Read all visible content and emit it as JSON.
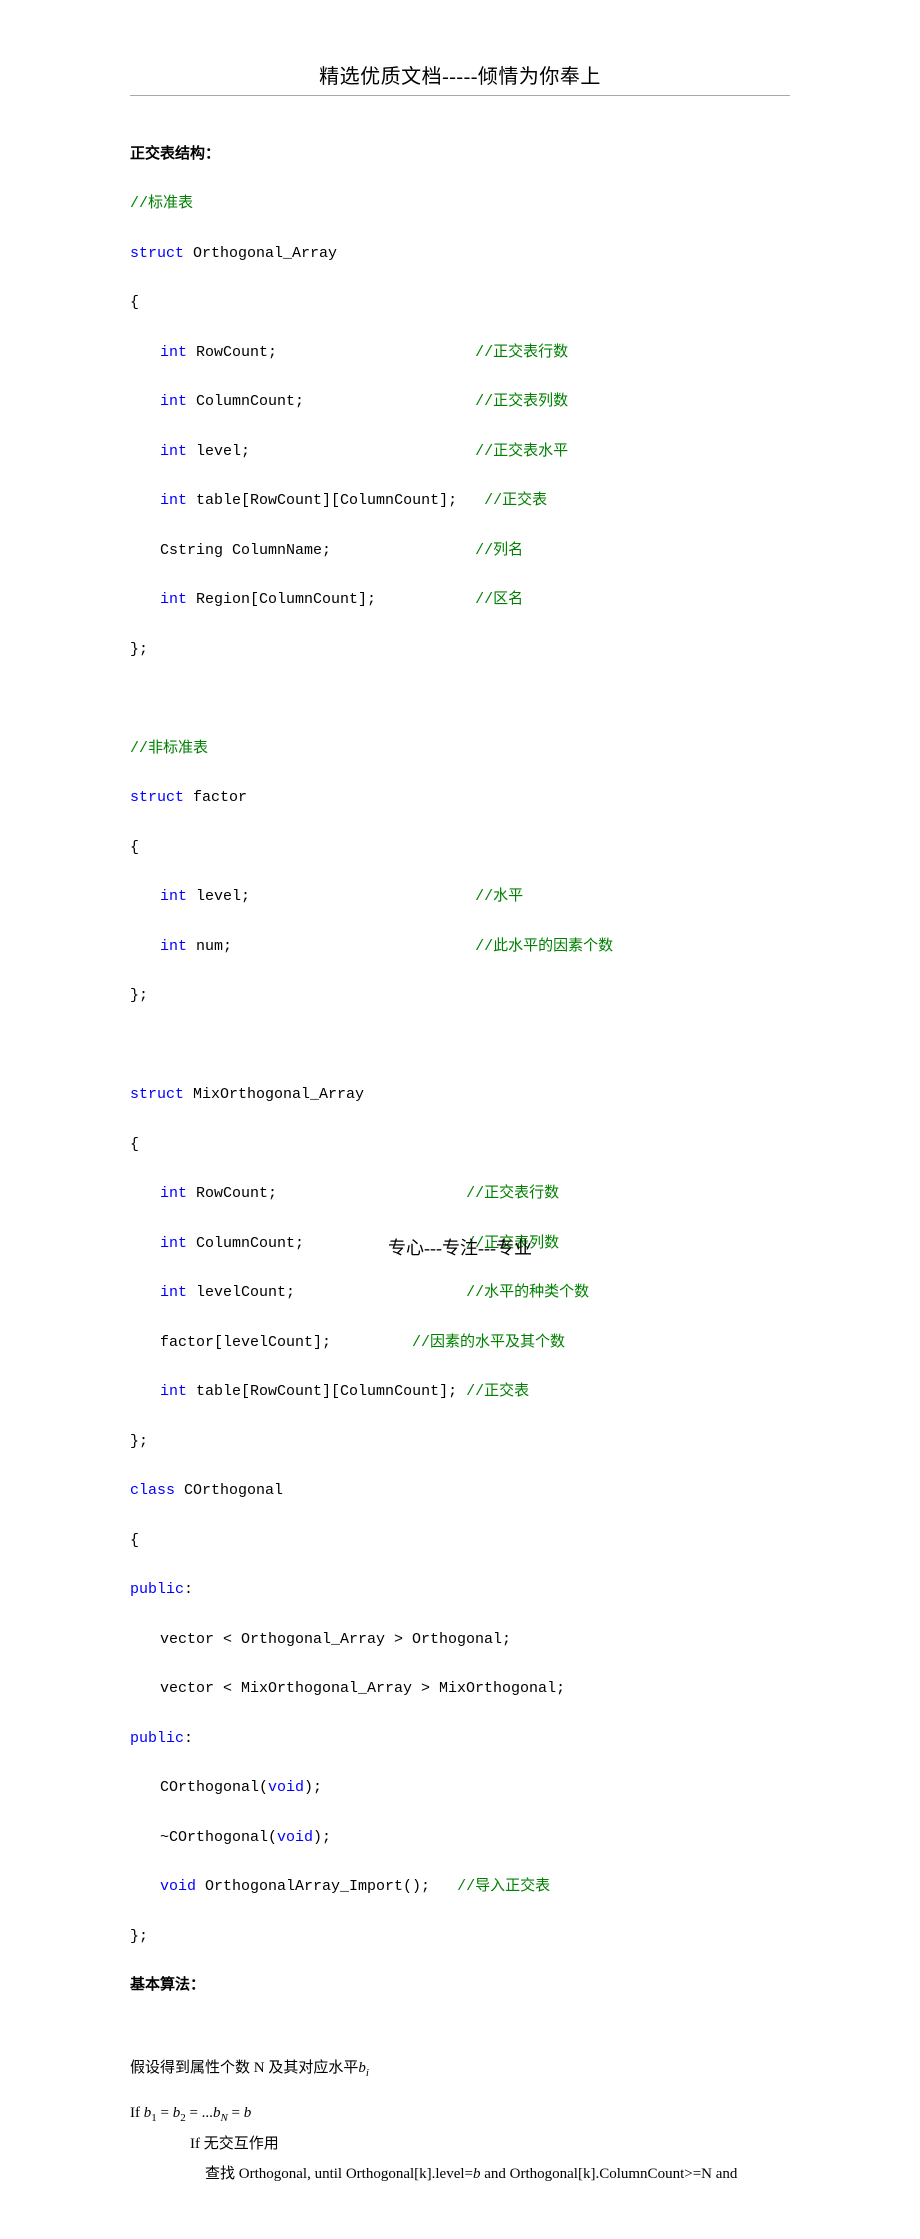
{
  "header": {
    "title": "精选优质文档-----倾情为你奉上"
  },
  "footer": {
    "text": "专心---专注---专业"
  },
  "doc": {
    "title_struct": "正交表结构：",
    "title_algo": "基本算法：",
    "c_std": "//标准表",
    "c_nstd": "//非标准表",
    "kw_struct": "struct",
    "kw_int": "int",
    "kw_class": "class",
    "kw_public": "public",
    "kw_void": "void",
    "id_oa": "Orthogonal_Array",
    "id_factor": "factor",
    "id_moa": "MixOrthogonal_Array",
    "id_corth": "COrthogonal",
    "lb": "{",
    "rb": "};",
    "rb_plain": "}",
    "colon": ":",
    "oa_row": "RowCount;",
    "oa_col": "ColumnCount;",
    "oa_level": "level;",
    "oa_table": "table[RowCount][ColumnCount];",
    "oa_cstring": "Cstring ColumnName;",
    "oa_region": "Region[ColumnCount];",
    "c_row": "//正交表行数",
    "c_col": "//正交表列数",
    "c_level": "//正交表水平",
    "c_table": "//正交表",
    "c_colname": "//列名",
    "c_region": "//区名",
    "f_level": "level;",
    "f_num": "num;",
    "c_flevel": "//水平",
    "c_fnum": "//此水平的因素个数",
    "m_row": "RowCount;",
    "m_col": "ColumnCount;",
    "m_levelcount": "levelCount;",
    "m_factor": "factor[levelCount];",
    "m_table": "table[RowCount][ColumnCount];",
    "c_mrow": "//正交表行数",
    "c_mcol": "//正交表列数",
    "c_mlevel": "//水平的种类个数",
    "c_mfactor": "//因素的水平及其个数",
    "c_mtable": "//正交表",
    "cls_vec1": "vector < Orthogonal_Array > Orthogonal;",
    "cls_vec2": "vector < MixOrthogonal_Array > MixOrthogonal;",
    "cls_ctor": "COrthogonal(",
    "cls_dtor": "~COrthogonal(",
    "cls_paren_close": ");",
    "cls_import_a": " OrthogonalArray_Import();",
    "c_import": "//导入正交表",
    "algo_l1_a": "假设得到属性个数 N 及其对应水平",
    "algo_l1_b": "b",
    "algo_l1_sub": "i",
    "algo_if": "If  ",
    "algo_eq": "b₁ = b₂ = ...bₙ = b",
    "algo_eq_b": "b",
    "algo_eq_1": "1",
    "algo_eq_2": "2",
    "algo_eq_N": "N",
    "algo_eq_eq": " = ",
    "algo_eq_dots": " = ...",
    "algo_eq_final": " = ",
    "algo_eq_rhs": "b",
    "algo_if2": "If 无交互作用",
    "algo_find_a": "查找 Orthogonal, until Orthogonal[k].level=",
    "algo_find_b": "b",
    "algo_find_c": " and Orthogonal[k].ColumnCount>=N and"
  }
}
